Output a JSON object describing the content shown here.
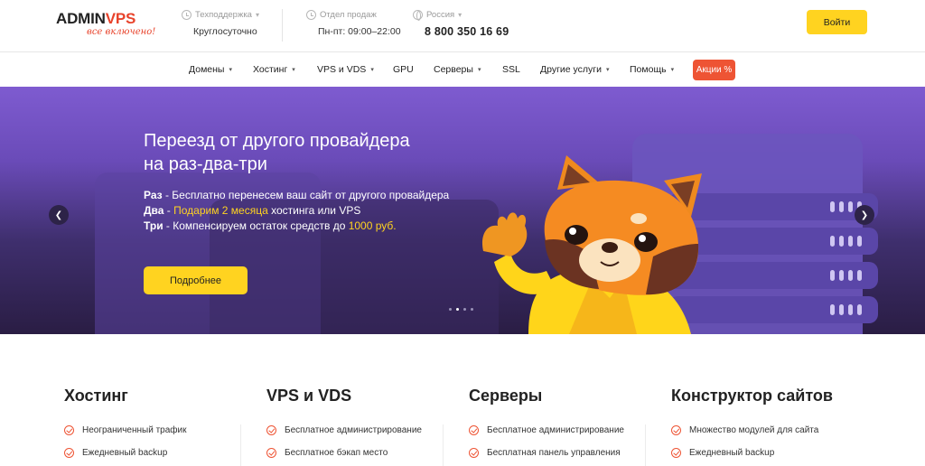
{
  "header": {
    "logo": {
      "main_left": "ADMIN",
      "main_right": "VPS",
      "tagline": "все включено!"
    },
    "support": {
      "label": "Техподдержка",
      "value": "Круглосуточно"
    },
    "sales": {
      "label": "Отдел продаж",
      "value": "Пн-пт: 09:00–22:00"
    },
    "region": {
      "label": "Россия",
      "phone": "8 800 350 16 69"
    },
    "login_label": "Войти"
  },
  "nav": {
    "items": [
      {
        "label": "Домены",
        "dropdown": true
      },
      {
        "label": "Хостинг",
        "dropdown": true
      },
      {
        "label": "VPS и VDS",
        "dropdown": true
      },
      {
        "label": "GPU",
        "dropdown": false
      },
      {
        "label": "Серверы",
        "dropdown": true
      },
      {
        "label": "SSL",
        "dropdown": false
      },
      {
        "label": "Другие услуги",
        "dropdown": true
      },
      {
        "label": "Помощь",
        "dropdown": true
      }
    ],
    "promo_label": "Акции %"
  },
  "hero": {
    "title_line1": "Переезд от другого провайдера",
    "title_line2": "на раз-два-три",
    "line1_key": "Раз",
    "line1_text": " - Бесплатно перенесем ваш сайт от другого провайдера",
    "line2_key": "Два",
    "line2_sep": " - ",
    "line2_highlight": "Подарим 2 месяца",
    "line2_text": " хостинга или VPS",
    "line3_key": "Три",
    "line3_text": " - Компенсируем остаток средств до ",
    "line3_highlight": "1000 руб.",
    "button_label": "Подробнее",
    "slide_count": 4,
    "active_slide": 1
  },
  "products": [
    {
      "title": "Хостинг",
      "features": [
        "Неограниченный трафик",
        "Ежедневный backup"
      ]
    },
    {
      "title": "VPS и VDS",
      "features": [
        "Бесплатное администрирование",
        "Бесплатное бэкап место"
      ]
    },
    {
      "title": "Серверы",
      "features": [
        "Бесплатное администрирование",
        "Бесплатная панель управления"
      ]
    },
    {
      "title": "Конструктор сайтов",
      "features": [
        "Множество модулей для сайта",
        "Ежедневный backup"
      ]
    }
  ],
  "colors": {
    "accent_yellow": "#ffd320",
    "accent_red": "#ee5434",
    "hero_purple": "#7e5bd0"
  },
  "icons": {
    "support": "clock-icon",
    "sales": "clock-icon",
    "region": "globe-icon",
    "check": "check-circle-icon"
  }
}
